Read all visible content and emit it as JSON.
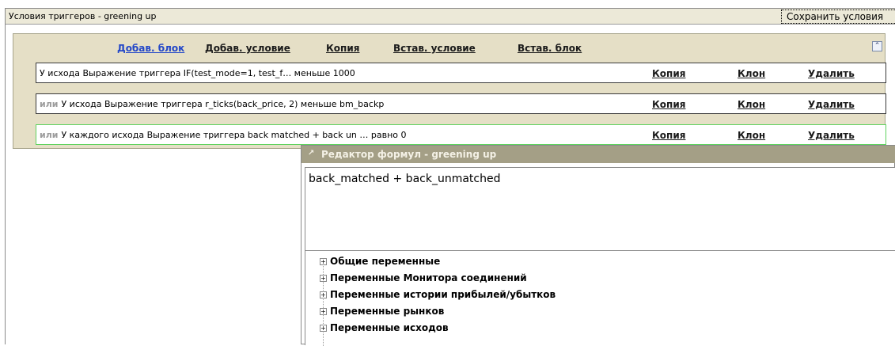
{
  "window": {
    "title": "Условия триггеров - greening up",
    "save_label": "Сохранить условия"
  },
  "toolbar": {
    "add_block": "Добав. блок",
    "add_condition": "Добав. условие",
    "copy": "Копия",
    "paste_condition": "Встав. условие",
    "paste_block": "Встав. блок",
    "collapse_icon": "double-chevron-up-icon"
  },
  "conditions": [
    {
      "prefix": "",
      "text": "У исхода   Выражение триггера   IF(test_mode=1, test_f…   меньше   1000",
      "copy": "Копия",
      "clone": "Клон",
      "delete": "Удалить"
    },
    {
      "prefix": "или",
      "text": "У исхода   Выражение триггера   r_ticks(back_price, 2)   меньше   bm_backp",
      "copy": "Копия",
      "clone": "Клон",
      "delete": "Удалить"
    },
    {
      "prefix": "или",
      "text": "У каждого исхода   Выражение триггера   back matched + back un …   равно   0",
      "copy": "Копия",
      "clone": "Клон",
      "delete": "Удалить"
    }
  ],
  "editor": {
    "title": "Редактор формул - greening up",
    "formula": "back_matched + back_unmatched",
    "tree": [
      "Общие переменные",
      "Переменные Монитора соединений",
      "Переменные истории прибылей/убытков",
      "Переменные рынков",
      "Переменные исходов"
    ]
  },
  "colors": {
    "panel_bg": "#e5dfc6",
    "editor_title_bg": "#a49f86",
    "primary_link": "#2347c8",
    "active_row_border": "#5fd25f"
  }
}
